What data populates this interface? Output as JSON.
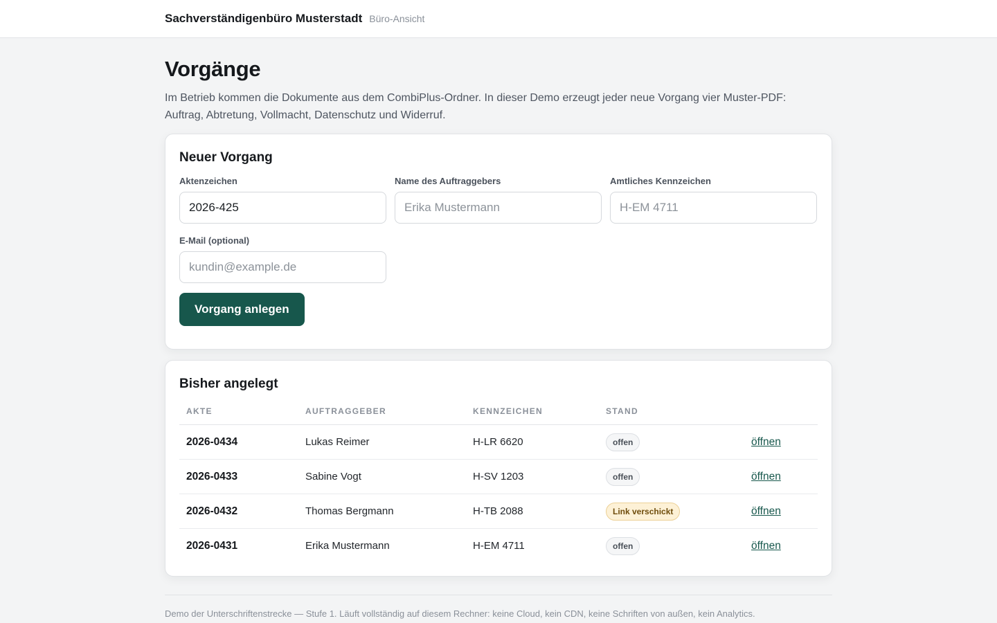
{
  "header": {
    "title": "Sachverständigenbüro Musterstadt",
    "subtitle": "Büro-Ansicht"
  },
  "page": {
    "title": "Vorgänge",
    "lead": "Im Betrieb kommen die Dokumente aus dem CombiPlus-Ordner. In dieser Demo erzeugt jeder neue Vorgang vier Muster-PDF: Auftrag, Abtretung, Vollmacht, Datenschutz und Widerruf."
  },
  "form": {
    "title": "Neuer Vorgang",
    "fields": {
      "aktenzeichen": {
        "label": "Aktenzeichen",
        "value": "2026-425",
        "placeholder": ""
      },
      "name": {
        "label": "Name des Auftraggebers",
        "value": "",
        "placeholder": "Erika Mustermann"
      },
      "kennzeichen": {
        "label": "Amtliches Kennzeichen",
        "value": "",
        "placeholder": "H-EM 4711"
      },
      "email": {
        "label": "E-Mail (optional)",
        "value": "",
        "placeholder": "kundin@example.de"
      }
    },
    "submit_label": "Vorgang anlegen"
  },
  "list": {
    "title": "Bisher angelegt",
    "columns": [
      "AKTE",
      "AUFTRAGGEBER",
      "KENNZEICHEN",
      "STAND",
      ""
    ],
    "rows": [
      {
        "akte": "2026-0434",
        "auftraggeber": "Lukas Reimer",
        "kennzeichen": "H-LR 6620",
        "stand": "offen",
        "action": "öffnen"
      },
      {
        "akte": "2026-0433",
        "auftraggeber": "Sabine Vogt",
        "kennzeichen": "H-SV 1203",
        "stand": "offen",
        "action": "öffnen"
      },
      {
        "akte": "2026-0432",
        "auftraggeber": "Thomas Bergmann",
        "kennzeichen": "H-TB 2088",
        "stand": "Link verschickt",
        "action": "öffnen"
      },
      {
        "akte": "2026-0431",
        "auftraggeber": "Erika Mustermann",
        "kennzeichen": "H-EM 4711",
        "stand": "offen",
        "action": "öffnen"
      }
    ]
  },
  "footer": {
    "text": "Demo der Unterschriftenstrecke — Stufe 1. Läuft vollständig auf diesem Rechner: keine Cloud, kein CDN, keine Schriften von außen, kein Analytics."
  },
  "colors": {
    "primary": "#17574c",
    "badge_sent_bg": "#fdf1d6"
  }
}
